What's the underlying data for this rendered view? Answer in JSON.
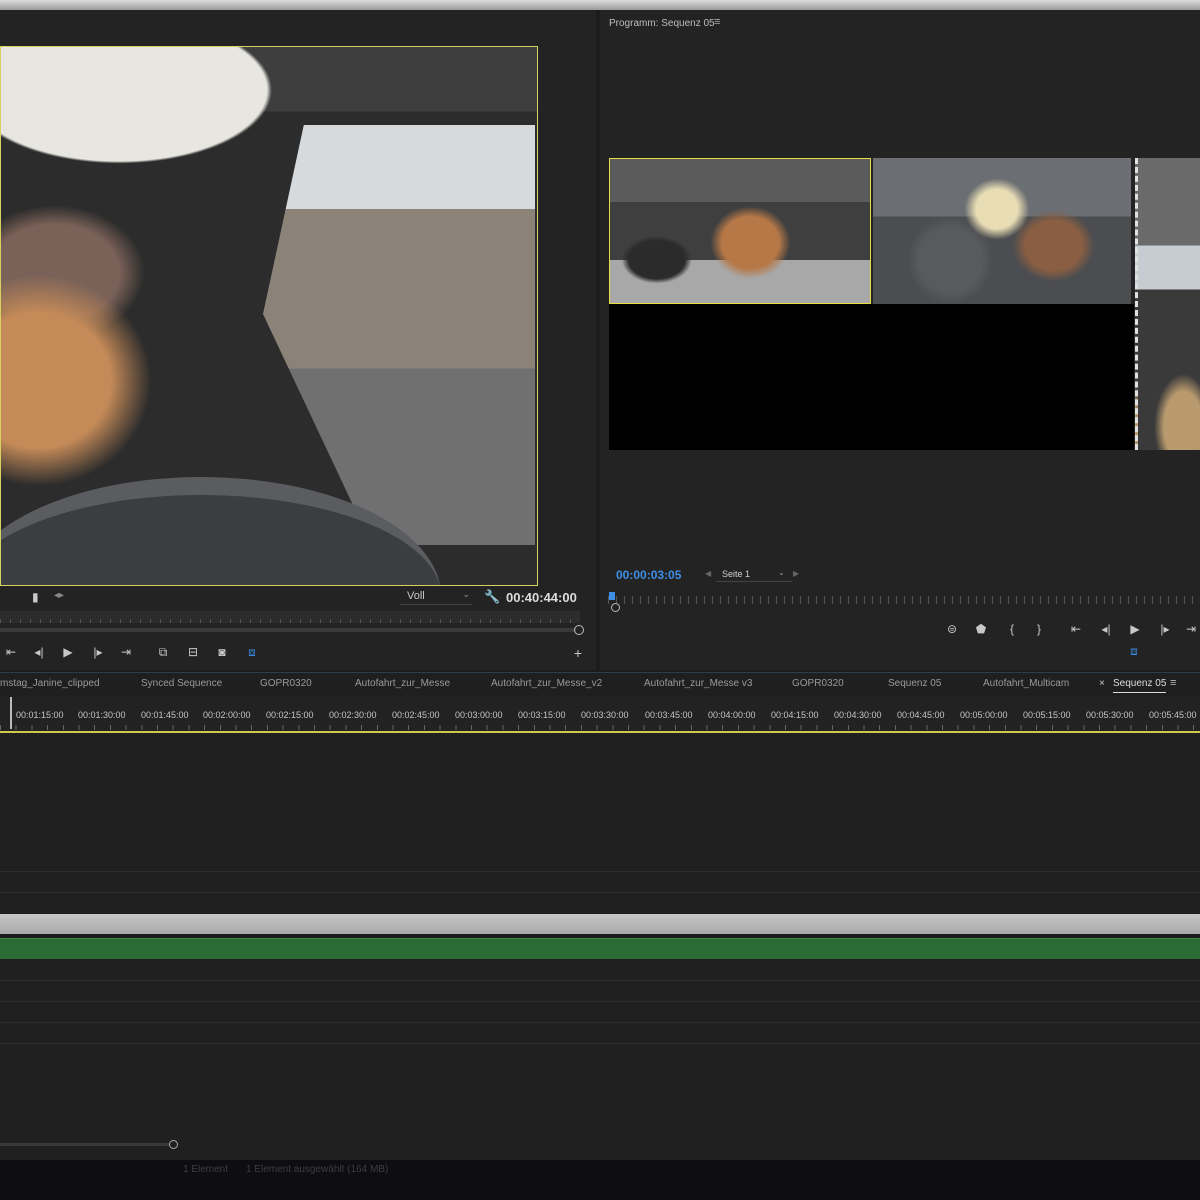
{
  "source_monitor": {
    "quality": "Voll",
    "timecode": "00:40:44:00",
    "icons": [
      "marker-icon",
      "step-back-frame-icon",
      "play-icon",
      "step-forward-frame-icon",
      "go-to-out-icon",
      "insert-icon",
      "overwrite-icon",
      "export-frame-icon",
      "button-editor-icon",
      "add-button-icon"
    ]
  },
  "program_monitor": {
    "title": "Programm: Sequenz 05",
    "menu_glyph": "≡",
    "timecode": "00:00:03:05",
    "page_label": "Seite 1",
    "icons": [
      "multicam-icon",
      "marker-icon",
      "mark-in-icon",
      "mark-out-icon",
      "go-to-in-icon",
      "step-back-frame-icon",
      "play-icon",
      "step-forward-frame-icon",
      "go-to-out-icon",
      "button-editor-icon"
    ]
  },
  "sequence_tabs": {
    "tabs": [
      "mstag_Janine_clipped",
      "Synced Sequence",
      "GOPR0320",
      "Autofahrt_zur_Messe",
      "Autofahrt_zur_Messe_v2",
      "Autofahrt_zur_Messe v3",
      "GOPR0320",
      "Sequenz 05",
      "Autofahrt_Multicam",
      "Sequenz 05"
    ],
    "close_glyph": "×",
    "menu_glyph": "≡"
  },
  "timeline": {
    "ruler_labels": [
      "00:01:15:00",
      "00:01:30:00",
      "00:01:45:00",
      "00:02:00:00",
      "00:02:15:00",
      "00:02:30:00",
      "00:02:45:00",
      "00:03:00:00",
      "00:03:15:00",
      "00:03:30:00",
      "00:03:45:00",
      "00:04:00:00",
      "00:04:15:00",
      "00:04:30:00",
      "00:04:45:00",
      "00:05:00:00",
      "00:05:15:00",
      "00:05:30:00",
      "00:05:45:00"
    ],
    "audio_clip_color": "#2a6b36",
    "selection_color": "#d4c84a"
  },
  "status_bar": {
    "items": "1 Element",
    "selected": "1 Element ausgewählt (164 MB)"
  },
  "colors": {
    "accent_blue": "#3d8fe6",
    "highlight_yellow": "#e8dc40"
  }
}
